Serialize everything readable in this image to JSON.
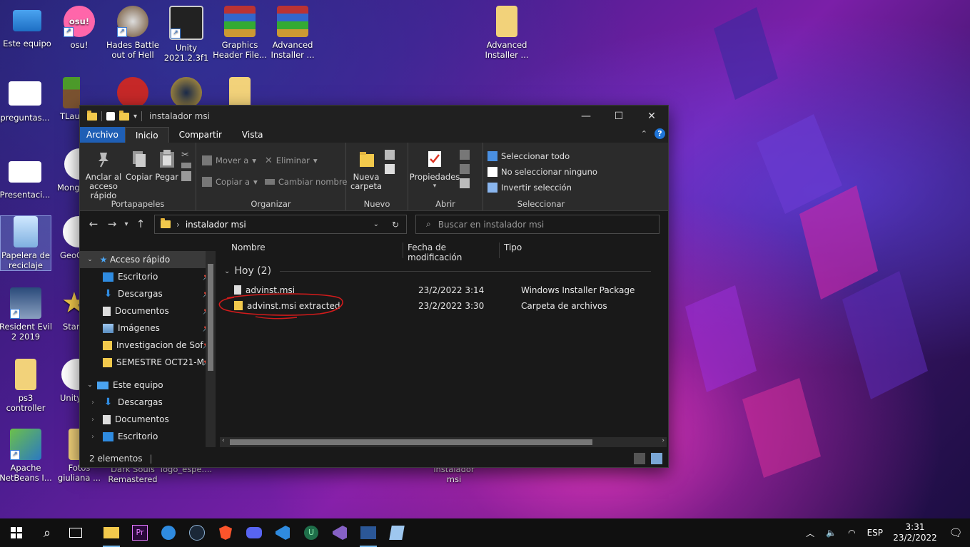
{
  "desktop": {
    "icons": [
      {
        "label": "Este equipo",
        "icon": "computer-icon"
      },
      {
        "label": "osu!",
        "icon": "osu-icon"
      },
      {
        "label": "Hades Battle out of Hell",
        "icon": "game-icon"
      },
      {
        "label": "Unity 2021.2.3f1",
        "icon": "unity-icon"
      },
      {
        "label": "Graphics Header File...",
        "icon": "winrar-icon"
      },
      {
        "label": "Advanced Installer ...",
        "icon": "winrar-icon"
      },
      {
        "label": "Advanced Installer ...",
        "icon": "folder-icon"
      },
      {
        "label": "preguntas...",
        "icon": "document-icon"
      },
      {
        "label": "TLaun",
        "icon": "minecraft-icon"
      },
      {
        "label": "Presentaci...",
        "icon": "powerpoint-icon"
      },
      {
        "label": "Mong",
        "icon": "mongo-icon"
      },
      {
        "label": "Papelera de reciclaje",
        "icon": "recycle-bin-icon"
      },
      {
        "label": "GeoG",
        "icon": "geogebra-icon"
      },
      {
        "label": "Resident Evil 2 2019",
        "icon": "game-icon"
      },
      {
        "label": "Starl",
        "icon": "star-icon"
      },
      {
        "label": "ps3 controller",
        "icon": "folder-icon"
      },
      {
        "label": "Unity",
        "icon": "unity-hub-icon"
      },
      {
        "label": "Apache NetBeans I...",
        "icon": "netbeans-icon"
      },
      {
        "label": "Fotos giuliana ...",
        "icon": "folder-icon"
      },
      {
        "label": "Dark Souls Remastered",
        "icon": "game-icon"
      },
      {
        "label": "logo_espe....",
        "icon": "image-icon"
      },
      {
        "label": "instalador msi",
        "icon": "folder-icon"
      }
    ]
  },
  "window": {
    "title": "instalador msi",
    "controls": {
      "minimize": "—",
      "maximize": "☐",
      "close": "✕"
    },
    "tabs": {
      "file": "Archivo",
      "home": "Inicio",
      "share": "Compartir",
      "view": "Vista"
    },
    "ribbon": {
      "clipboard": {
        "pin": "Anclar al acceso rápido",
        "copy": "Copiar",
        "paste": "Pegar",
        "label": "Portapapeles"
      },
      "organize": {
        "move": "Mover a",
        "copy_to": "Copiar a",
        "delete": "Eliminar",
        "rename": "Cambiar nombre",
        "label": "Organizar"
      },
      "new": {
        "new_folder": "Nueva carpeta",
        "label": "Nuevo"
      },
      "open": {
        "properties": "Propiedades",
        "label": "Abrir"
      },
      "select": {
        "all": "Seleccionar todo",
        "none": "No seleccionar ninguno",
        "invert": "Invertir selección",
        "label": "Seleccionar"
      }
    },
    "address": {
      "path": "instalador msi",
      "search_placeholder": "Buscar en instalador msi"
    },
    "nav": {
      "quick_access": "Acceso rápido",
      "quick_items": [
        "Escritorio",
        "Descargas",
        "Documentos",
        "Imágenes",
        "Investigacion de Sof",
        "SEMESTRE OCT21-M"
      ],
      "this_pc": "Este equipo",
      "pc_items": [
        "Descargas",
        "Documentos",
        "Escritorio"
      ]
    },
    "columns": {
      "name": "Nombre",
      "modified": "Fecha de modificación",
      "type": "Tipo"
    },
    "group": "Hoy (2)",
    "files": [
      {
        "name": "advinst.msi",
        "modified": "23/2/2022 3:14",
        "type": "Windows Installer Package"
      },
      {
        "name": "advinst.msi extracted",
        "modified": "23/2/2022 3:30",
        "type": "Carpeta de archivos"
      }
    ],
    "status": "2 elementos"
  },
  "taskbar": {
    "language": "ESP",
    "time": "3:31",
    "date": "23/2/2022"
  },
  "colors": {
    "accent": "#1f5fb5",
    "folder": "#f2c94c",
    "annotation": "#d21b1b"
  }
}
